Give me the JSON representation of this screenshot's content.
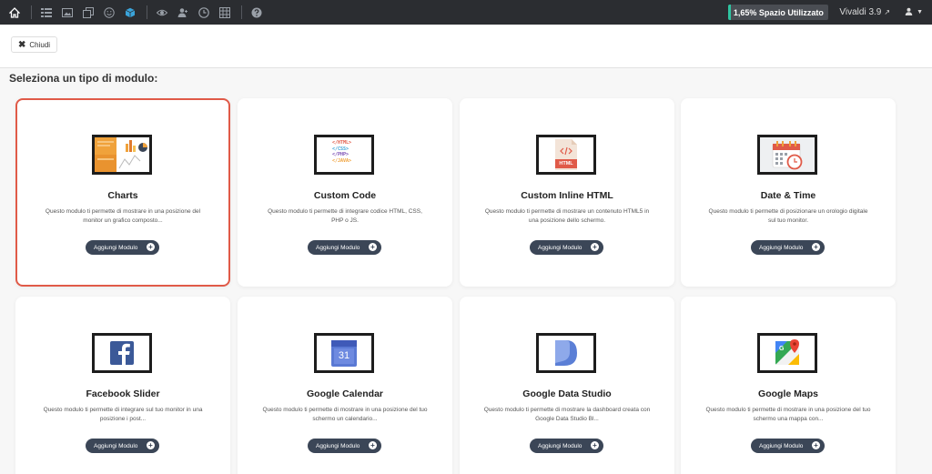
{
  "topbar": {
    "icons": [
      "home-icon",
      "list-icon",
      "image-icon",
      "copy-icon",
      "smiley-icon",
      "cube-icon",
      "eye-icon",
      "user-group-icon",
      "clock-icon",
      "grid-icon",
      "help-icon"
    ],
    "usage_label": "1,65% Spazio Utilizzato",
    "usage_fraction": 0.0165,
    "version": "Vivaldi 3.9",
    "colors": {
      "bar": "#2b2d31",
      "usage_fill": "#2ec4a0",
      "accent_cube": "#3aa3d9"
    }
  },
  "actionbar": {
    "close_label": "Chiudi"
  },
  "heading": "Seleziona un tipo di modulo:",
  "button_label": "Aggiungi Modulo",
  "modules": [
    {
      "title": "Charts",
      "desc": "Questo modulo ti permette di mostrare in una posizione del monitor un grafico composto...",
      "icon": "charts-icon",
      "selected": true
    },
    {
      "title": "Custom Code",
      "desc": "Questo modulo ti permette di integrare codice HTML, CSS, PHP o JS.",
      "icon": "code-list-icon",
      "code_lines": [
        "</HTML>",
        "</CSS>",
        "</PHP>",
        "</JAVA>"
      ]
    },
    {
      "title": "Custom Inline HTML",
      "desc": "Questo modulo ti permette di mostrare un contenuto HTML5 in una posizione dello schermo.",
      "icon": "html-file-icon",
      "file_label": "HTML"
    },
    {
      "title": "Date & Time",
      "desc": "Questo modulo ti permette di posizionare un orologio digitale sul tuo monitor.",
      "icon": "calendar-clock-icon"
    },
    {
      "title": "Facebook Slider",
      "desc": "Questo modulo ti permette di integrare sul tuo monitor in una posizione i post...",
      "icon": "facebook-icon"
    },
    {
      "title": "Google Calendar",
      "desc": "Questo modulo ti permette di mostrare in una posizione del tuo schermo un calendario...",
      "icon": "google-calendar-icon",
      "day": "31"
    },
    {
      "title": "Google Data Studio",
      "desc": "Questo modulo ti permette di mostrare la dashboard creata con Google Data Studio Bl...",
      "icon": "data-studio-icon"
    },
    {
      "title": "Google Maps",
      "desc": "Questo modulo ti permette di mostrare in una posizione del tuo schermo una mappa con...",
      "icon": "google-maps-icon"
    }
  ]
}
